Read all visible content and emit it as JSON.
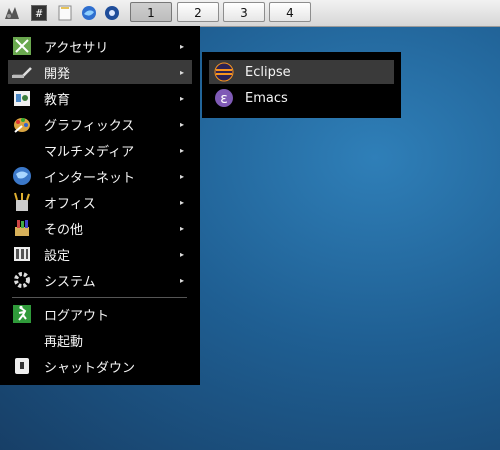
{
  "taskbar": {
    "launchers": [
      {
        "icon": "menu-icon"
      },
      {
        "icon": "terminal-icon",
        "glyph": "#"
      },
      {
        "icon": "notes-icon"
      },
      {
        "icon": "browser-icon"
      },
      {
        "icon": "settings-icon"
      }
    ],
    "workspaces": [
      {
        "label": "1",
        "active": true
      },
      {
        "label": "2",
        "active": false
      },
      {
        "label": "3",
        "active": false
      },
      {
        "label": "4",
        "active": false
      }
    ]
  },
  "main_menu": {
    "items": [
      {
        "label": "アクセサリ",
        "icon": "accessories-icon",
        "has_submenu": true
      },
      {
        "label": "開発",
        "icon": "development-icon",
        "has_submenu": true,
        "highlighted": true
      },
      {
        "label": "教育",
        "icon": "education-icon",
        "has_submenu": true
      },
      {
        "label": "グラフィックス",
        "icon": "graphics-icon",
        "has_submenu": true
      },
      {
        "label": "マルチメディア",
        "icon": "",
        "has_submenu": true
      },
      {
        "label": "インターネット",
        "icon": "internet-icon",
        "has_submenu": true
      },
      {
        "label": "オフィス",
        "icon": "office-icon",
        "has_submenu": true
      },
      {
        "label": "その他",
        "icon": "other-icon",
        "has_submenu": true
      },
      {
        "label": "設定",
        "icon": "preferences-icon",
        "has_submenu": true
      },
      {
        "label": "システム",
        "icon": "system-icon",
        "has_submenu": true
      }
    ],
    "session": [
      {
        "label": "ログアウト",
        "icon": "logout-icon"
      },
      {
        "label": "再起動",
        "icon": ""
      },
      {
        "label": "シャットダウン",
        "icon": "shutdown-icon"
      }
    ],
    "arrow": "▸"
  },
  "sub_menu": {
    "items": [
      {
        "label": "Eclipse",
        "icon": "eclipse-icon",
        "highlighted": true
      },
      {
        "label": "Emacs",
        "icon": "emacs-icon",
        "glyph": "ε"
      }
    ]
  },
  "colors": {
    "menu_bg": "#000000",
    "menu_highlight": "#3a3a3a",
    "desktop": "#1f5f93"
  }
}
